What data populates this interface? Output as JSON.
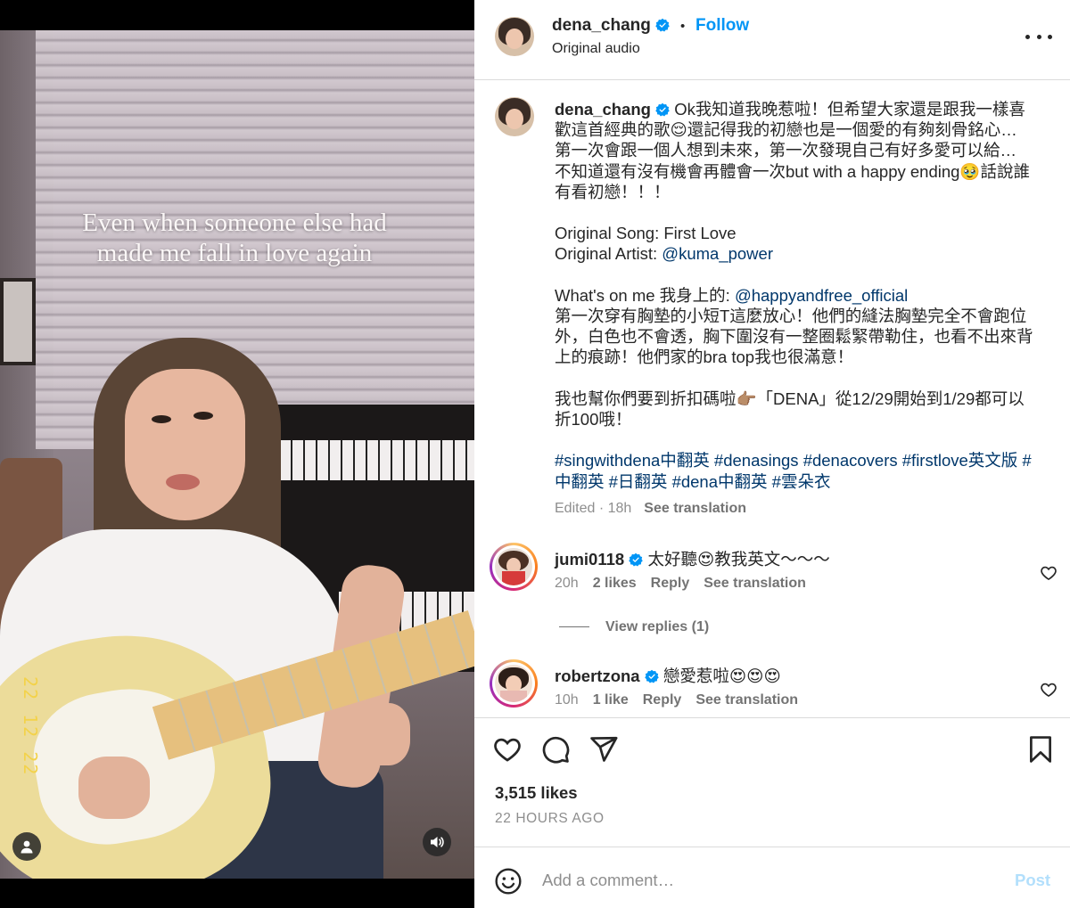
{
  "media": {
    "overlay_line1": "Even when someone else had",
    "overlay_line2": "made me fall in love again",
    "date_stamp": "22 12 22"
  },
  "header": {
    "username": "dena_chang",
    "separator": "•",
    "follow_label": "Follow",
    "audio_label": "Original audio"
  },
  "caption": {
    "username": "dena_chang",
    "line1": "Ok我知道我晚惹啦！但希望大家還是跟我一樣喜歡這首經典的歌😌還記得我的初戀也是一個愛的有夠刻骨銘心… 第一次會跟一個人想到未來，第一次發現自己有好多愛可以給… 不知道還有沒有機會再體會一次but with a happy ending🥹話說誰有看初戀！！！",
    "song_label": "Original Song: First Love",
    "artist_prefix": "Original Artist: ",
    "artist_link": "@kuma_power",
    "wear_prefix": "What's on me 我身上的: ",
    "wear_link": "@happyandfree_official",
    "wear_text": "第一次穿有胸墊的小短T這麼放心！他們的縫法胸墊完全不會跑位外，白色也不會透，胸下圍沒有一整圈鬆緊帶勒住，也看不出來背上的痕跡！他們家的bra top我也很滿意！",
    "discount_text": "我也幫你們要到折扣碼啦👉🏽「DENA」從12/29開始到1/29都可以折100哦！",
    "hashtags": "#singwithdena中翻英 #denasings #denacovers #firstlove英文版 #中翻英 #日翻英 #dena中翻英 #雲朵衣",
    "meta": "Edited · 18h",
    "see_translation": "See translation"
  },
  "comments": [
    {
      "username": "jumi0118",
      "text": "太好聽😍教我英文～～～",
      "time": "20h",
      "likes": "2 likes",
      "reply": "Reply",
      "see_translation": "See translation"
    },
    {
      "username": "robertzona",
      "text": "戀愛惹啦😍😍😍",
      "time": "10h",
      "likes": "1 like",
      "reply": "Reply",
      "see_translation": "See translation"
    }
  ],
  "view_replies": "View replies (1)",
  "footer": {
    "likes": "3,515 likes",
    "time_ago": "22 HOURS AGO",
    "comment_placeholder": "Add a comment…",
    "post_label": "Post"
  },
  "colors": {
    "accent": "#0095f6",
    "link": "#00376b",
    "muted": "#8e8e8e",
    "post_disabled": "#b2dffc",
    "verified": "#0095f6"
  }
}
